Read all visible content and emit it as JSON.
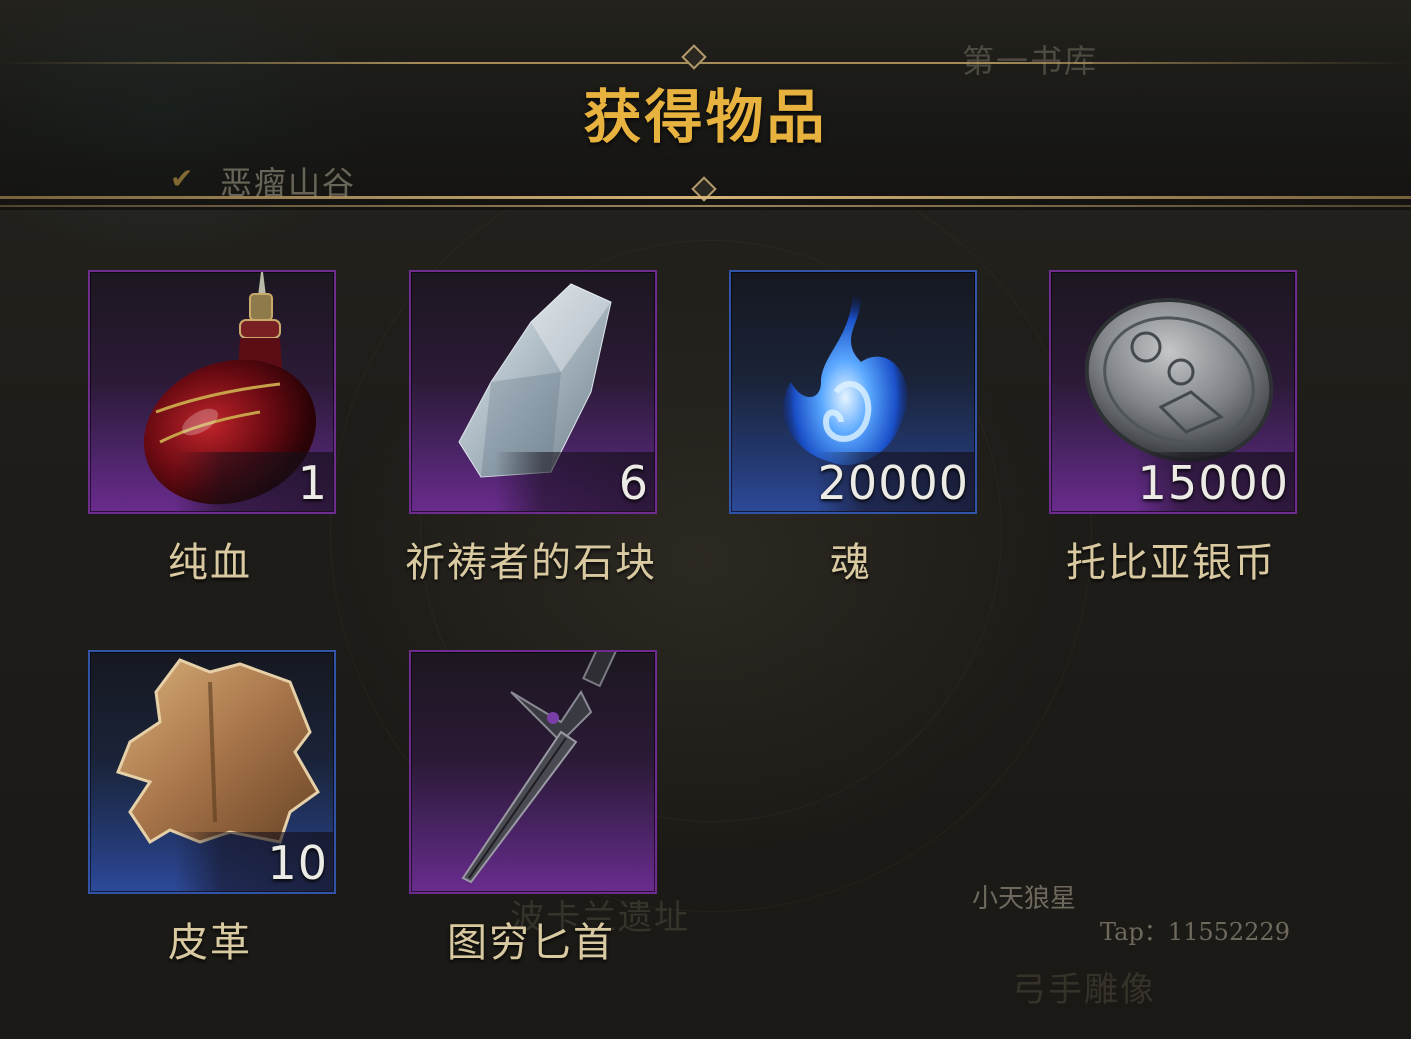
{
  "header": {
    "title": "获得物品",
    "location": "恶瘤山谷",
    "top_right_text": "第一书库"
  },
  "background_labels": {
    "bottom_center": "波卡兰遗址",
    "bottom_right": "弓手雕像"
  },
  "items": [
    {
      "name": "纯血",
      "quantity": "1",
      "rarity": "purple",
      "icon": "blood-flask-icon"
    },
    {
      "name": "祈祷者的石块",
      "quantity": "6",
      "rarity": "purple",
      "icon": "prayer-stone-icon"
    },
    {
      "name": "魂",
      "quantity": "20000",
      "rarity": "blue",
      "icon": "soul-flame-icon"
    },
    {
      "name": "托比亚银币",
      "quantity": "15000",
      "rarity": "purple",
      "icon": "silver-coin-icon"
    },
    {
      "name": "皮革",
      "quantity": "10",
      "rarity": "blue",
      "icon": "leather-hide-icon"
    },
    {
      "name": "图穷匕首",
      "quantity": "",
      "rarity": "purple",
      "icon": "dagger-icon"
    }
  ],
  "watermark": {
    "name": "小天狼星",
    "tap": "Tap：11552229"
  },
  "colors": {
    "title_gold": "#e8b23f",
    "purple_rarity": "#6a2c8e",
    "blue_rarity": "#2d4a9a",
    "item_name": "#d8c9a0"
  }
}
